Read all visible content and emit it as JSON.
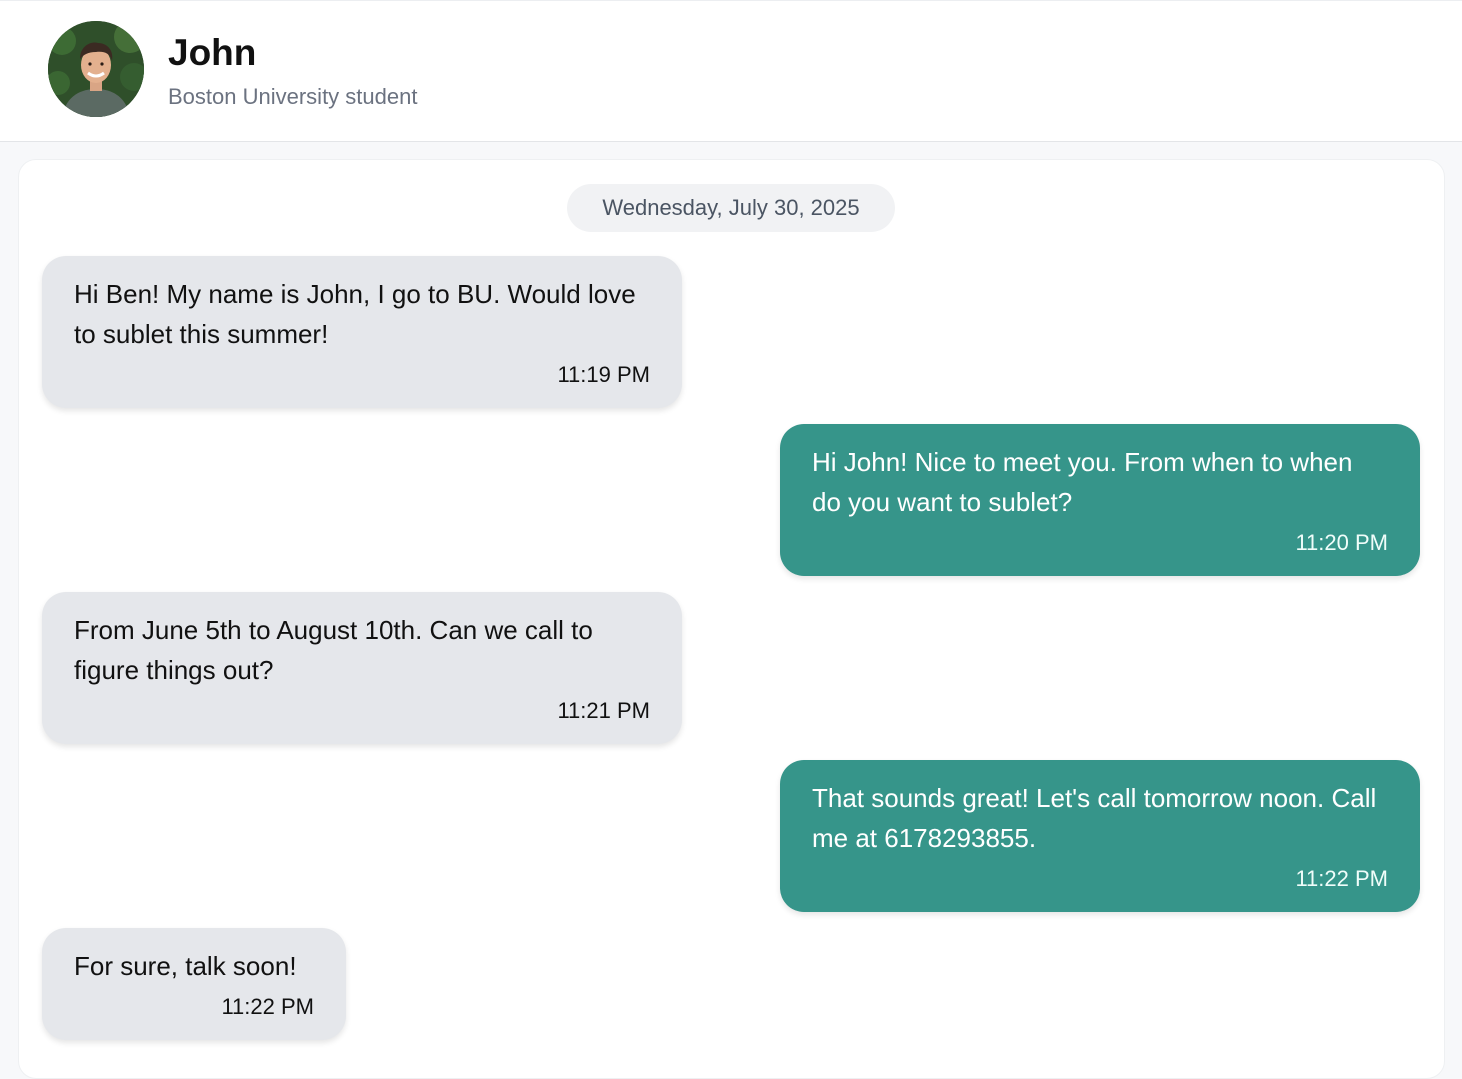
{
  "contact": {
    "name": "John",
    "subtitle": "Boston University student",
    "avatar_icon": "user-photo-avatar"
  },
  "chat": {
    "date_separator": "Wednesday, July 30, 2025",
    "messages": [
      {
        "direction": "incoming",
        "text": "Hi Ben! My name is John, I go to BU. Would love to sublet this summer!",
        "time": "11:19 PM"
      },
      {
        "direction": "outgoing",
        "text": "Hi John! Nice to meet you. From when to when do you want to sublet?",
        "time": "11:20 PM"
      },
      {
        "direction": "incoming",
        "text": "From June 5th to August 10th. Can we call to figure things out?",
        "time": "11:21 PM"
      },
      {
        "direction": "outgoing",
        "text": "That sounds great! Let's call tomorrow noon. Call me at 6178293855.",
        "time": "11:22 PM"
      },
      {
        "direction": "incoming",
        "text": "For sure, talk soon!",
        "time": "11:22 PM"
      }
    ]
  },
  "colors": {
    "incoming_bubble": "#e5e7eb",
    "outgoing_bubble": "#36958a",
    "date_pill": "#f1f2f4"
  }
}
